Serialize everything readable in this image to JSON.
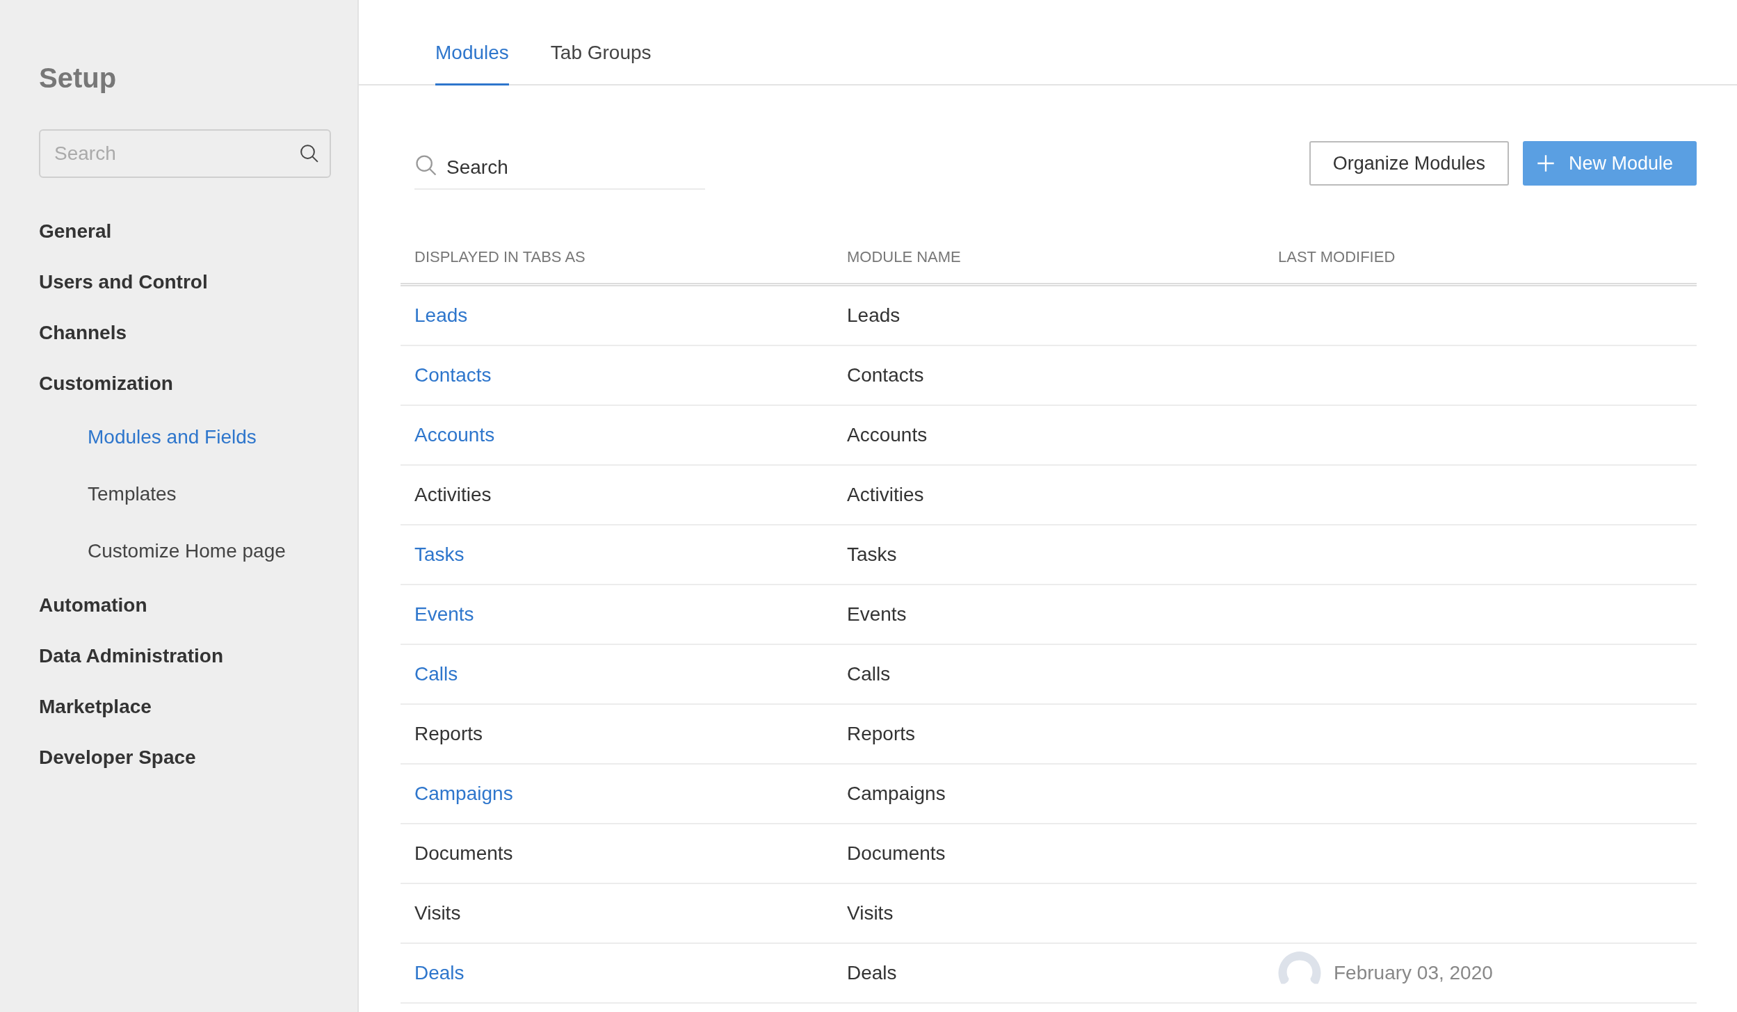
{
  "sidebar": {
    "title": "Setup",
    "search": {
      "placeholder": "Search"
    },
    "items": [
      {
        "label": "General",
        "selected": false
      },
      {
        "label": "Users and Control",
        "selected": false
      },
      {
        "label": "Channels",
        "selected": false
      },
      {
        "label": "Customization",
        "selected": false,
        "children": [
          {
            "label": "Modules and Fields",
            "selected": true
          },
          {
            "label": "Templates",
            "selected": false
          },
          {
            "label": "Customize Home page",
            "selected": false
          }
        ]
      },
      {
        "label": "Automation",
        "selected": false
      },
      {
        "label": "Data Administration",
        "selected": false
      },
      {
        "label": "Marketplace",
        "selected": false
      },
      {
        "label": "Developer Space",
        "selected": false
      }
    ]
  },
  "tabs": [
    {
      "label": "Modules",
      "selected": true
    },
    {
      "label": "Tab Groups",
      "selected": false
    }
  ],
  "search": {
    "placeholder": "Search"
  },
  "buttons": [
    {
      "kind": "outline",
      "label": "Organize Modules"
    },
    {
      "kind": "primary",
      "label": "New Module"
    }
  ],
  "table": {
    "columns": [
      "DISPLAYED IN TABS AS",
      "MODULE NAME",
      "LAST MODIFIED"
    ],
    "rows": [
      {
        "tab": "Leads",
        "link": true,
        "module": "Leads"
      },
      {
        "tab": "Contacts",
        "link": true,
        "module": "Contacts"
      },
      {
        "tab": "Accounts",
        "link": true,
        "module": "Accounts"
      },
      {
        "tab": "Activities",
        "link": false,
        "module": "Activities"
      },
      {
        "tab": "Tasks",
        "link": true,
        "module": "Tasks"
      },
      {
        "tab": "Events",
        "link": true,
        "module": "Events"
      },
      {
        "tab": "Calls",
        "link": true,
        "module": "Calls"
      },
      {
        "tab": "Reports",
        "link": false,
        "module": "Reports"
      },
      {
        "tab": "Campaigns",
        "link": true,
        "module": "Campaigns"
      },
      {
        "tab": "Documents",
        "link": false,
        "module": "Documents"
      },
      {
        "tab": "Visits",
        "link": false,
        "module": "Visits"
      },
      {
        "tab": "Deals",
        "link": true,
        "module": "Deals",
        "modified": "February 03, 2020"
      }
    ]
  }
}
